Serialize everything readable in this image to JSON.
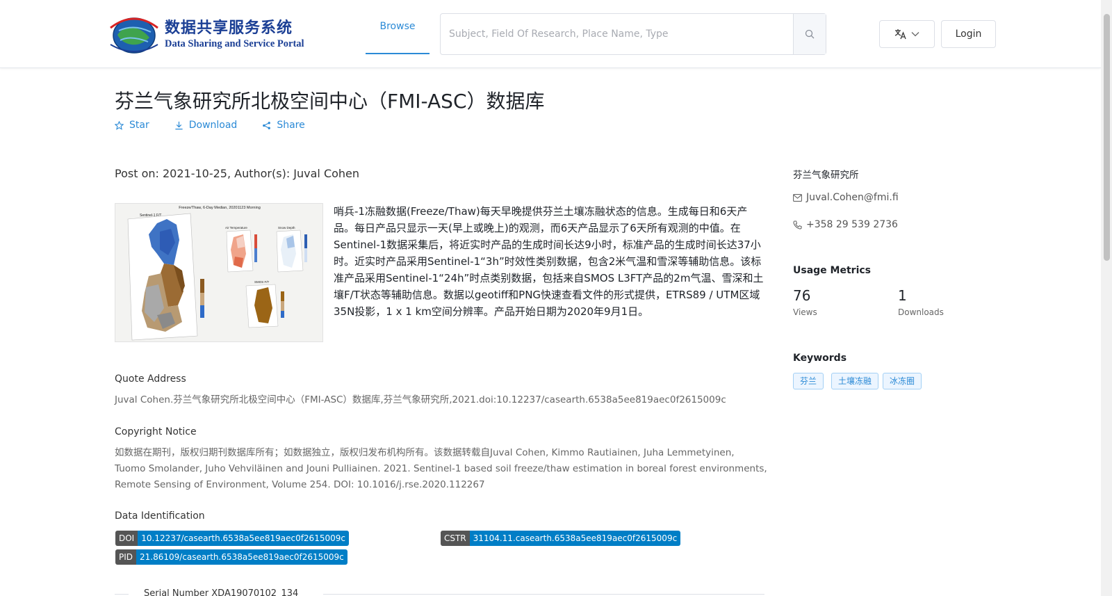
{
  "header": {
    "logo": {
      "title_cn": "数据共享服务系统",
      "title_en": "Data Sharing and Service Portal",
      "emblem_text_cn": "地球大数据科学数据中心",
      "emblem_text_en": "Big Earth Data Center, CAS"
    },
    "nav": {
      "browse_label": "Browse"
    },
    "search": {
      "placeholder": "Subject, Field Of Research, Place Name, Type",
      "value": ""
    },
    "language_icon": "translate-icon",
    "login_label": "Login"
  },
  "dataset": {
    "title": "芬兰气象研究所北极空间中心（FMI-ASC）数据库",
    "actions": {
      "star": "Star",
      "download": "Download",
      "share": "Share"
    },
    "post_info": "Post on: 2021-10-25, Author(s): Juval Cohen",
    "preview": {
      "title": "Freeze/Thaw, 6-Day Median, 20201123 Morning",
      "label_main": "Sentinel-1 F/T",
      "label_air": "Air Temperature",
      "label_snow": "Snow Depth",
      "label_smos": "SMOS F/T"
    },
    "description": "哨兵-1冻融数据(Freeze/Thaw)每天早晚提供芬兰土壤冻融状态的信息。生成每日和6天产品。每日产品只显示一天(早上或晚上)的观测，而6天产品显示了6天所有观测的中值。在Sentinel-1数据采集后，将近实时产品的生成时间长达9小时，标准产品的生成时间长达37小时。近实时产品采用Sentinel-1“3h”时效性类别数据，包含2米气温和雪深等辅助信息。该标准产品采用Sentinel-1“24h”时点类别数据，包括来自SMOS L3FT产品的2m气温、雪深和土壤F/T状态等辅助信息。数据以geotiff和PNG快速查看文件的形式提供，ETRS89 / UTM区域35N投影，1 x 1 km空间分辨率。产品开始日期为2020年9月1日。",
    "quote": {
      "heading": "Quote Address",
      "text": "Juval Cohen.芬兰气象研究所北极空间中心（FMI-ASC）数据库,芬兰气象研究所,2021.doi:10.12237/casearth.6538a5ee819aec0f2615009c"
    },
    "copyright": {
      "heading": "Copyright Notice",
      "text": "如数据在期刊，版权归期刊数据库所有；如数据独立，版权归发布机构所有。该数据转载自Juval Cohen, Kimmo Rautiainen, Juha Lemmetyinen, Tuomo Smolander, Juho Vehviläinen and Jouni Pulliainen. 2021. Sentinel-1 based soil freeze/thaw estimation in boreal forest environments, Remote Sensing of Environment, Volume 254. DOI: 10.1016/j.rse.2020.112267"
    },
    "identification": {
      "heading": "Data Identification",
      "doi": {
        "tag": "DOI",
        "value": "10.12237/casearth.6538a5ee819aec0f2615009c"
      },
      "cstr": {
        "tag": "CSTR",
        "value": "31104.11.casearth.6538a5ee819aec0f2615009c"
      },
      "pid": {
        "tag": "PID",
        "value": "21.86109/casearth.6538a5ee819aec0f2615009c"
      }
    },
    "serial_number": "Serial Number XDA19070102_134"
  },
  "sidebar": {
    "organization": "芬兰气象研究所",
    "email": "Juval.Cohen@fmi.fi",
    "phone": "+358 29 539 2736",
    "usage": {
      "heading": "Usage Metrics",
      "views": 76,
      "views_label": "Views",
      "downloads": 1,
      "downloads_label": "Downloads"
    },
    "keywords": {
      "heading": "Keywords",
      "items": [
        "芬兰",
        "土壤冻融",
        "冰冻圈"
      ]
    }
  },
  "colors": {
    "accent": "#2b8ad6",
    "brand_navy": "#1b3f95",
    "badge_tag": "#555555",
    "badge_value": "#007ec6"
  }
}
